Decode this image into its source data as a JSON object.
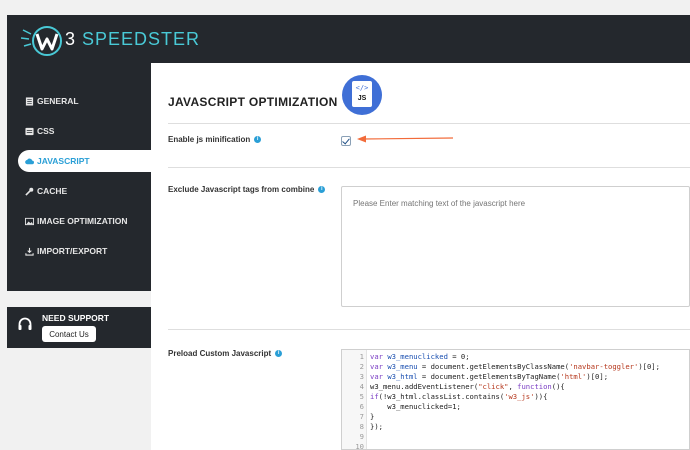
{
  "brand": {
    "num": "3",
    "rest": " SPEEDSTER"
  },
  "sidebar": {
    "items": [
      {
        "label": "GENERAL",
        "icon": "document-icon"
      },
      {
        "label": "CSS",
        "icon": "css-icon"
      },
      {
        "label": "JAVASCRIPT",
        "icon": "cloud-icon",
        "active": true
      },
      {
        "label": "CACHE",
        "icon": "wrench-icon"
      },
      {
        "label": "IMAGE OPTIMIZATION",
        "icon": "image-icon"
      },
      {
        "label": "IMPORT/EXPORT",
        "icon": "import-export-icon"
      }
    ]
  },
  "support": {
    "title": "NEED SUPPORT",
    "button": "Contact Us"
  },
  "page": {
    "title": "JAVASCRIPT OPTIMIZATION",
    "badge_tag": "</>",
    "badge_label": "JS"
  },
  "fields": {
    "minify_label": "Enable js minification",
    "minify_checked": true,
    "exclude_label": "Exclude Javascript tags from combine",
    "exclude_placeholder": "Please Enter matching text of the javascript here",
    "preload_label": "Preload Custom Javascript"
  },
  "editor": {
    "line_numbers": [
      "1",
      "2",
      "3",
      "4",
      "5",
      "6",
      "7",
      "8",
      "9",
      "10"
    ]
  },
  "colors": {
    "accent": "#2a9fd6",
    "sidebar": "#24282d",
    "brand_cyan": "#49c9d6",
    "arrow": "#f26b3a",
    "badge": "#3f6fd6"
  }
}
